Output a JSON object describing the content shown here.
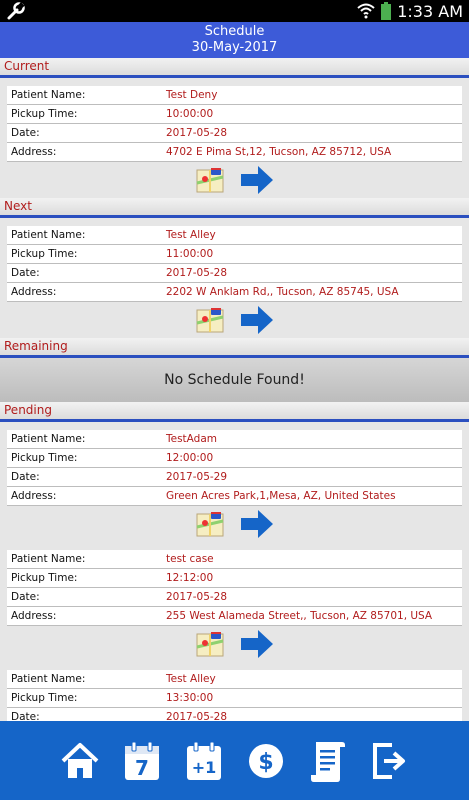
{
  "status_bar": {
    "time": "1:33 AM"
  },
  "header": {
    "title": "Schedule",
    "date": "30-May-2017"
  },
  "labels": {
    "patient": "Patient Name:",
    "pickup": "Pickup Time:",
    "date": "Date:",
    "address": "Address:"
  },
  "sections": {
    "current": {
      "title": "Current",
      "items": [
        {
          "patient": "Test Deny",
          "pickup": "10:00:00",
          "date": "2017-05-28",
          "address": "4702 E Pima St,12, Tucson, AZ 85712, USA"
        }
      ]
    },
    "next": {
      "title": "Next",
      "items": [
        {
          "patient": "Test Alley",
          "pickup": "11:00:00",
          "date": "2017-05-28",
          "address": "2202 W Anklam Rd,, Tucson, AZ 85745, USA"
        }
      ]
    },
    "remaining": {
      "title": "Remaining",
      "empty_text": "No Schedule Found!"
    },
    "pending": {
      "title": "Pending",
      "items": [
        {
          "patient": "TestAdam",
          "pickup": "12:00:00",
          "date": "2017-05-29",
          "address": "Green Acres Park,1,Mesa, AZ, United States"
        },
        {
          "patient": "test case",
          "pickup": "12:12:00",
          "date": "2017-05-28",
          "address": "255 West Alameda Street,, Tucson, AZ 85701, USA"
        },
        {
          "patient": "Test Alley",
          "pickup": "13:30:00",
          "date": "2017-05-28",
          "address": ""
        }
      ]
    }
  },
  "nav": {
    "calendar_day": "7",
    "calendar_plus": "+1",
    "currency": "$"
  },
  "colors": {
    "accent": "#3d5bd8",
    "nav": "#1565c8",
    "value_text": "#b11c1c",
    "arrow": "#1565c8"
  }
}
